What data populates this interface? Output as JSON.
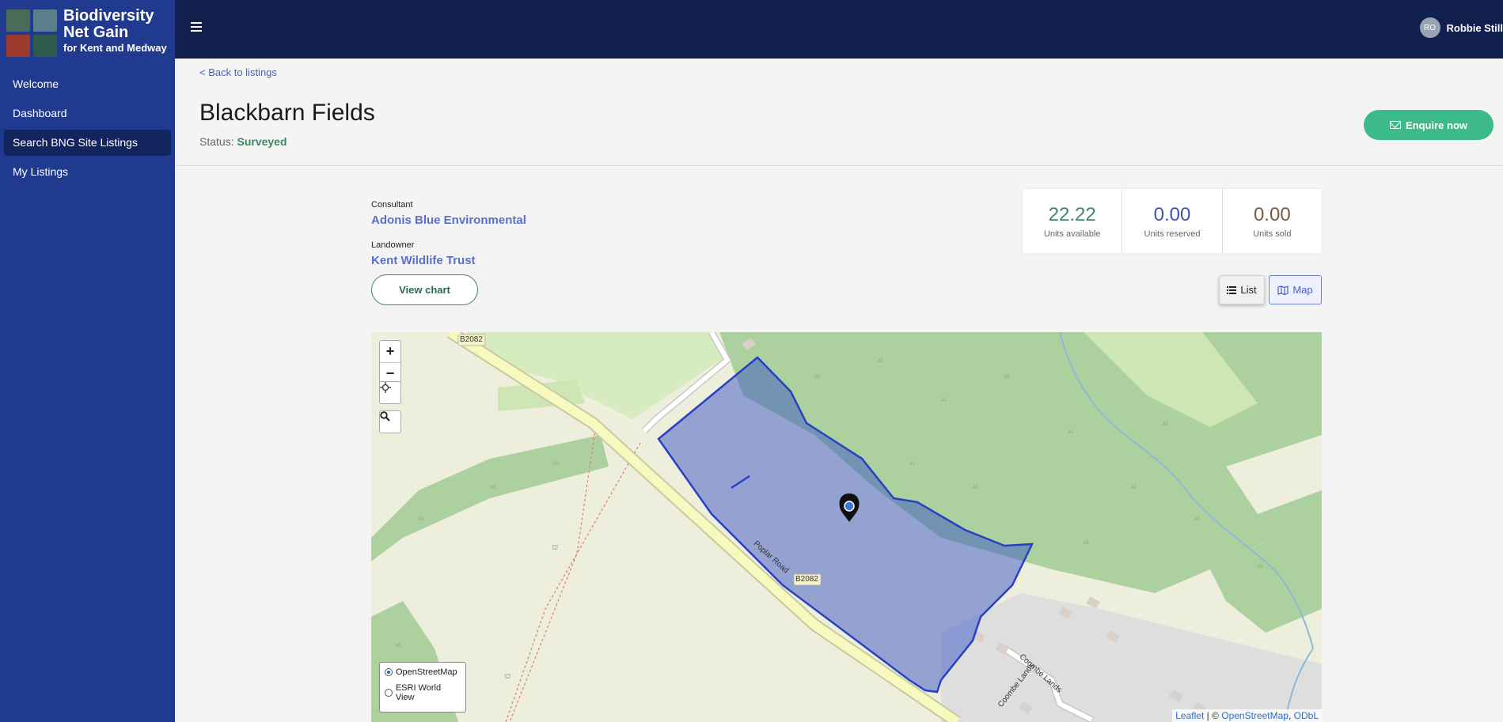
{
  "brand": {
    "line1": "Biodiversity",
    "line2": "Net Gain",
    "line3": "for Kent and Medway",
    "tile_colors": [
      "#4a6b57",
      "#5a7f8a",
      "#9c3a2d",
      "#2f5a4d"
    ]
  },
  "sidebar": {
    "items": [
      {
        "label": "Welcome",
        "active": false
      },
      {
        "label": "Dashboard",
        "active": false
      },
      {
        "label": "Search BNG Site Listings",
        "active": true
      },
      {
        "label": "My Listings",
        "active": false
      }
    ]
  },
  "topbar": {
    "menu_icon": "hamburger-icon",
    "user": {
      "initials": "RO",
      "name": "Robbie Still"
    }
  },
  "header": {
    "back_link": "< Back to listings",
    "title": "Blackbarn Fields",
    "status_label": "Status:",
    "status_value": "Surveyed",
    "enquire_label": "Enquire now"
  },
  "details": {
    "consultant_label": "Consultant",
    "consultant_value": "Adonis Blue Environmental",
    "landowner_label": "Landowner",
    "landowner_value": "Kent Wildlife Trust",
    "view_chart_label": "View chart"
  },
  "stats": [
    {
      "value": "22.22",
      "label": "Units available",
      "color": "#3b8a63"
    },
    {
      "value": "0.00",
      "label": "Units reserved",
      "color": "#3a55b8"
    },
    {
      "value": "0.00",
      "label": "Units sold",
      "color": "#7a5a3a"
    }
  ],
  "view_toggle": {
    "list_label": "List",
    "map_label": "Map",
    "selected": "Map"
  },
  "map": {
    "zoom_in": "+",
    "zoom_out": "−",
    "road_labels": [
      "B2082",
      "B2082",
      "Poplar Road",
      "Coombe Lands",
      "Coombe Lands"
    ],
    "layers": [
      {
        "label": "OpenStreetMap",
        "selected": true
      },
      {
        "label": "ESRI World View",
        "selected": false
      }
    ],
    "attribution_leaflet": "Leaflet",
    "attribution_sep": " | © ",
    "attribution_osm": "OpenStreetMap",
    "attribution_odbl": "ODbL",
    "polygon_color": "#3a55c8"
  }
}
